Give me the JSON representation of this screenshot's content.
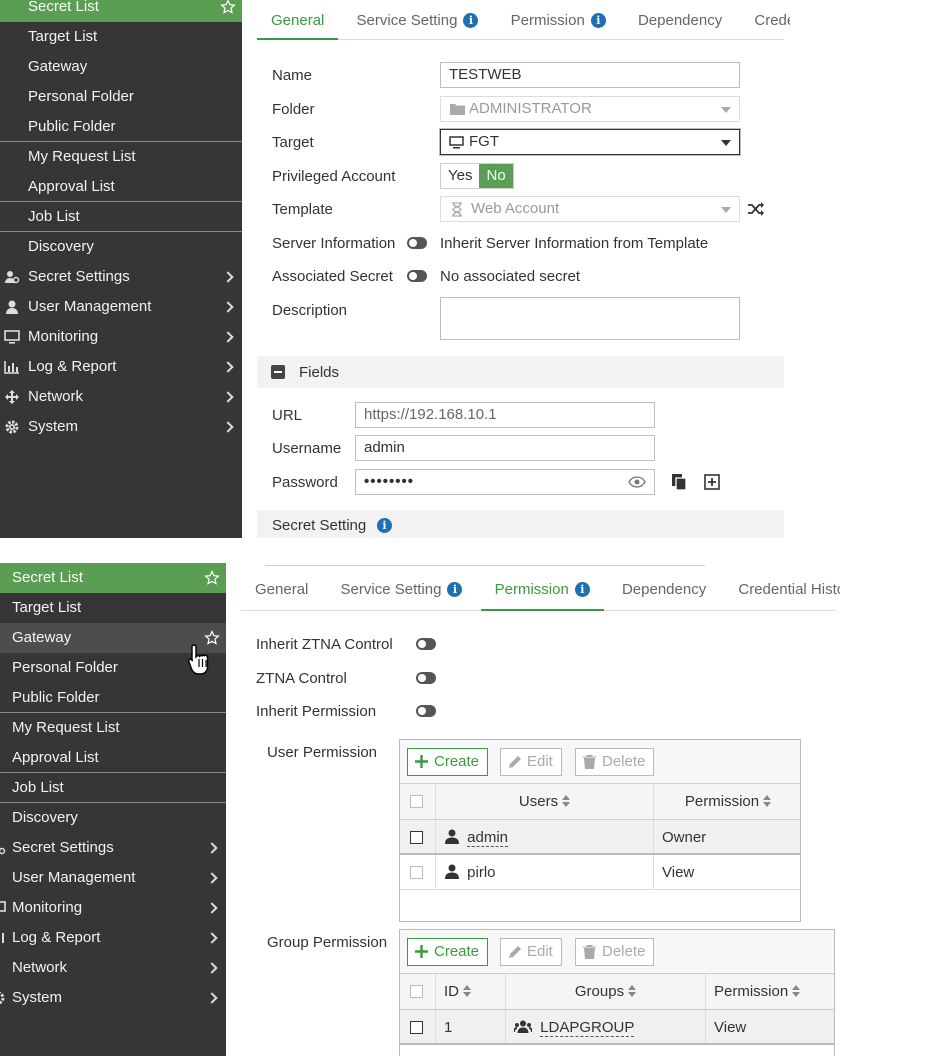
{
  "panel1": {
    "sidebar": {
      "items": [
        {
          "label": "Secret List"
        },
        {
          "label": "Target List"
        },
        {
          "label": "Gateway"
        },
        {
          "label": "Personal Folder"
        },
        {
          "label": "Public Folder"
        },
        {
          "label": "My Request List"
        },
        {
          "label": "Approval List"
        },
        {
          "label": "Job List"
        },
        {
          "label": "Discovery"
        },
        {
          "label": "Secret Settings"
        },
        {
          "label": "User Management"
        },
        {
          "label": "Monitoring"
        },
        {
          "label": "Log & Report"
        },
        {
          "label": "Network"
        },
        {
          "label": "System"
        }
      ]
    },
    "tabs": [
      "General",
      "Service Setting",
      "Permission",
      "Dependency",
      "Crede"
    ],
    "form": {
      "name_label": "Name",
      "name_value": "TESTWEB",
      "folder_label": "Folder",
      "folder_value": "ADMINISTRATOR",
      "target_label": "Target",
      "target_value": "FGT",
      "priv_label": "Privileged Account",
      "priv_yes": "Yes",
      "priv_no": "No",
      "template_label": "Template",
      "template_value": "Web Account",
      "server_info_label": "Server Information",
      "server_info_value": "Inherit Server Information from Template",
      "assoc_label": "Associated Secret",
      "assoc_value": "No associated secret",
      "desc_label": "Description"
    },
    "fields_section": "Fields",
    "fields": {
      "url_label": "URL",
      "url_value": "https://192.168.10.1",
      "user_label": "Username",
      "user_value": "admin",
      "pass_label": "Password",
      "pass_value": "••••••••"
    },
    "secret_setting_section": "Secret Setting"
  },
  "panel2": {
    "sidebar": {
      "items": [
        {
          "label": "Secret List"
        },
        {
          "label": "Target List"
        },
        {
          "label": "Gateway"
        },
        {
          "label": "Personal Folder"
        },
        {
          "label": "Public Folder"
        },
        {
          "label": "My Request List"
        },
        {
          "label": "Approval List"
        },
        {
          "label": "Job List"
        },
        {
          "label": "Discovery"
        },
        {
          "label": "Secret Settings"
        },
        {
          "label": "User Management"
        },
        {
          "label": "Monitoring"
        },
        {
          "label": "Log & Report"
        },
        {
          "label": "Network"
        },
        {
          "label": "System"
        }
      ]
    },
    "tabs": [
      "General",
      "Service Setting",
      "Permission",
      "Dependency",
      "Credential Histo"
    ],
    "inherit_ztna_label": "Inherit ZTNA Control",
    "ztna_label": "ZTNA Control",
    "inherit_perm_label": "Inherit Permission",
    "user_perm": {
      "label": "User Permission",
      "create": "Create",
      "edit": "Edit",
      "delete": "Delete",
      "columns": [
        "Users",
        "Permission"
      ],
      "rows": [
        {
          "user": "admin",
          "permission": "Owner"
        },
        {
          "user": "pirlo",
          "permission": "View"
        }
      ]
    },
    "group_perm": {
      "label": "Group Permission",
      "create": "Create",
      "edit": "Edit",
      "delete": "Delete",
      "columns": [
        "ID",
        "Groups",
        "Permission"
      ],
      "rows": [
        {
          "id": "1",
          "group": "LDAPGROUP",
          "permission": "View"
        }
      ]
    }
  }
}
